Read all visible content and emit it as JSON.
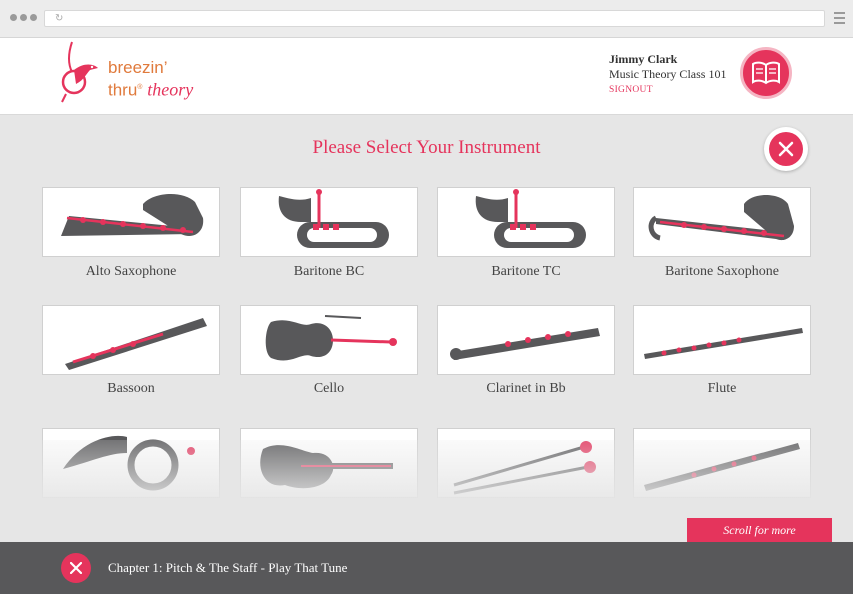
{
  "header": {
    "logo_line1": "breezin’",
    "logo_line2_thru": "thru",
    "logo_line2_theory": "theory",
    "user_name": "Jimmy Clark",
    "user_class": "Music Theory Class 101",
    "signout": "SIGNOUT"
  },
  "main": {
    "title": "Please Select Your Instrument",
    "instruments": [
      {
        "label": "Alto Saxophone",
        "icon": "saxophone-icon"
      },
      {
        "label": "Baritone BC",
        "icon": "baritone-icon"
      },
      {
        "label": "Baritone TC",
        "icon": "baritone-icon"
      },
      {
        "label": "Baritone Saxophone",
        "icon": "baritone-saxophone-icon"
      },
      {
        "label": "Bassoon",
        "icon": "bassoon-icon"
      },
      {
        "label": "Cello",
        "icon": "cello-icon"
      },
      {
        "label": "Clarinet in Bb",
        "icon": "clarinet-icon"
      },
      {
        "label": "Flute",
        "icon": "flute-icon"
      },
      {
        "label": "",
        "icon": "french-horn-icon"
      },
      {
        "label": "",
        "icon": "guitar-icon"
      },
      {
        "label": "",
        "icon": "mallets-icon"
      },
      {
        "label": "",
        "icon": "oboe-icon"
      }
    ],
    "scroll_label": "Scroll for more"
  },
  "footer": {
    "chapter": "Chapter 1: Pitch & The Staff - Play That Tune"
  },
  "colors": {
    "accent": "#e5345c",
    "instrument_gray": "#58585a",
    "footer_bg": "#58585a"
  }
}
